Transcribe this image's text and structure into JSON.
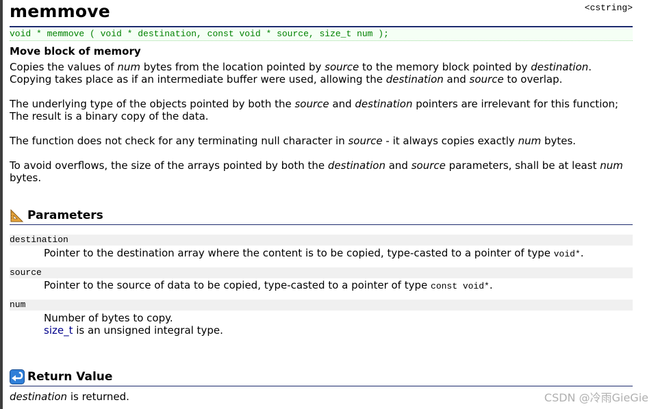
{
  "header": {
    "title": "memmove",
    "library": "<cstring>"
  },
  "prototype": "void * memmove ( void * destination, const void * source, size_t num );",
  "summary": "Move block of memory",
  "description": {
    "p1": {
      "l1_a": "Copies the values of ",
      "l1_b": "num",
      "l1_c": " bytes from the location pointed by ",
      "l1_d": "source",
      "l1_e": " to the memory block pointed by ",
      "l1_f": "destination",
      "l1_g": ".",
      "l2_a": "Copying takes place as if an intermediate buffer were used, allowing the ",
      "l2_b": "destination",
      "l2_c": " and ",
      "l2_d": "source",
      "l2_e": " to overlap."
    },
    "p2": {
      "l1_a": "The underlying type of the objects pointed by both the ",
      "l1_b": "source",
      "l1_c": " and ",
      "l1_d": "destination",
      "l1_e": " pointers are irrelevant for this function;",
      "l2": "The result is a binary copy of the data."
    },
    "p3": {
      "a": "The function does not check for any terminating null character in ",
      "b": "source",
      "c": " - it always copies exactly ",
      "d": "num",
      "e": " bytes."
    },
    "p4": {
      "l1_a": "To avoid overflows, the size of the arrays pointed by both the ",
      "l1_b": "destination",
      "l1_c": " and ",
      "l1_d": "source",
      "l1_e": " parameters, shall be at least ",
      "l1_f": "num",
      "l2": "bytes."
    }
  },
  "parameters": {
    "heading": "Parameters",
    "icon": "ruler-triangle-icon",
    "items": [
      {
        "term": "destination",
        "desc_a": "Pointer to the destination array where the content is to be copied, type-casted to a pointer of type ",
        "desc_code": "void*",
        "desc_b": "."
      },
      {
        "term": "source",
        "desc_a": "Pointer to the source of data to be copied, type-casted to a pointer of type ",
        "desc_code": "const void*",
        "desc_b": "."
      },
      {
        "term": "num",
        "desc_l1": "Number of bytes to copy.",
        "desc_l2_link": "size_t",
        "desc_l2_rest": " is an unsigned integral type."
      }
    ]
  },
  "return_value": {
    "heading": "Return Value",
    "icon": "return-arrow-icon",
    "text_a": "destination",
    "text_b": " is returned."
  },
  "watermark": "CSDN @冷雨GieGie",
  "colors": {
    "prototype_text": "#008000",
    "section_rule": "#1c2a6e",
    "param_bg": "#f0f0f0",
    "link": "#00008b"
  }
}
